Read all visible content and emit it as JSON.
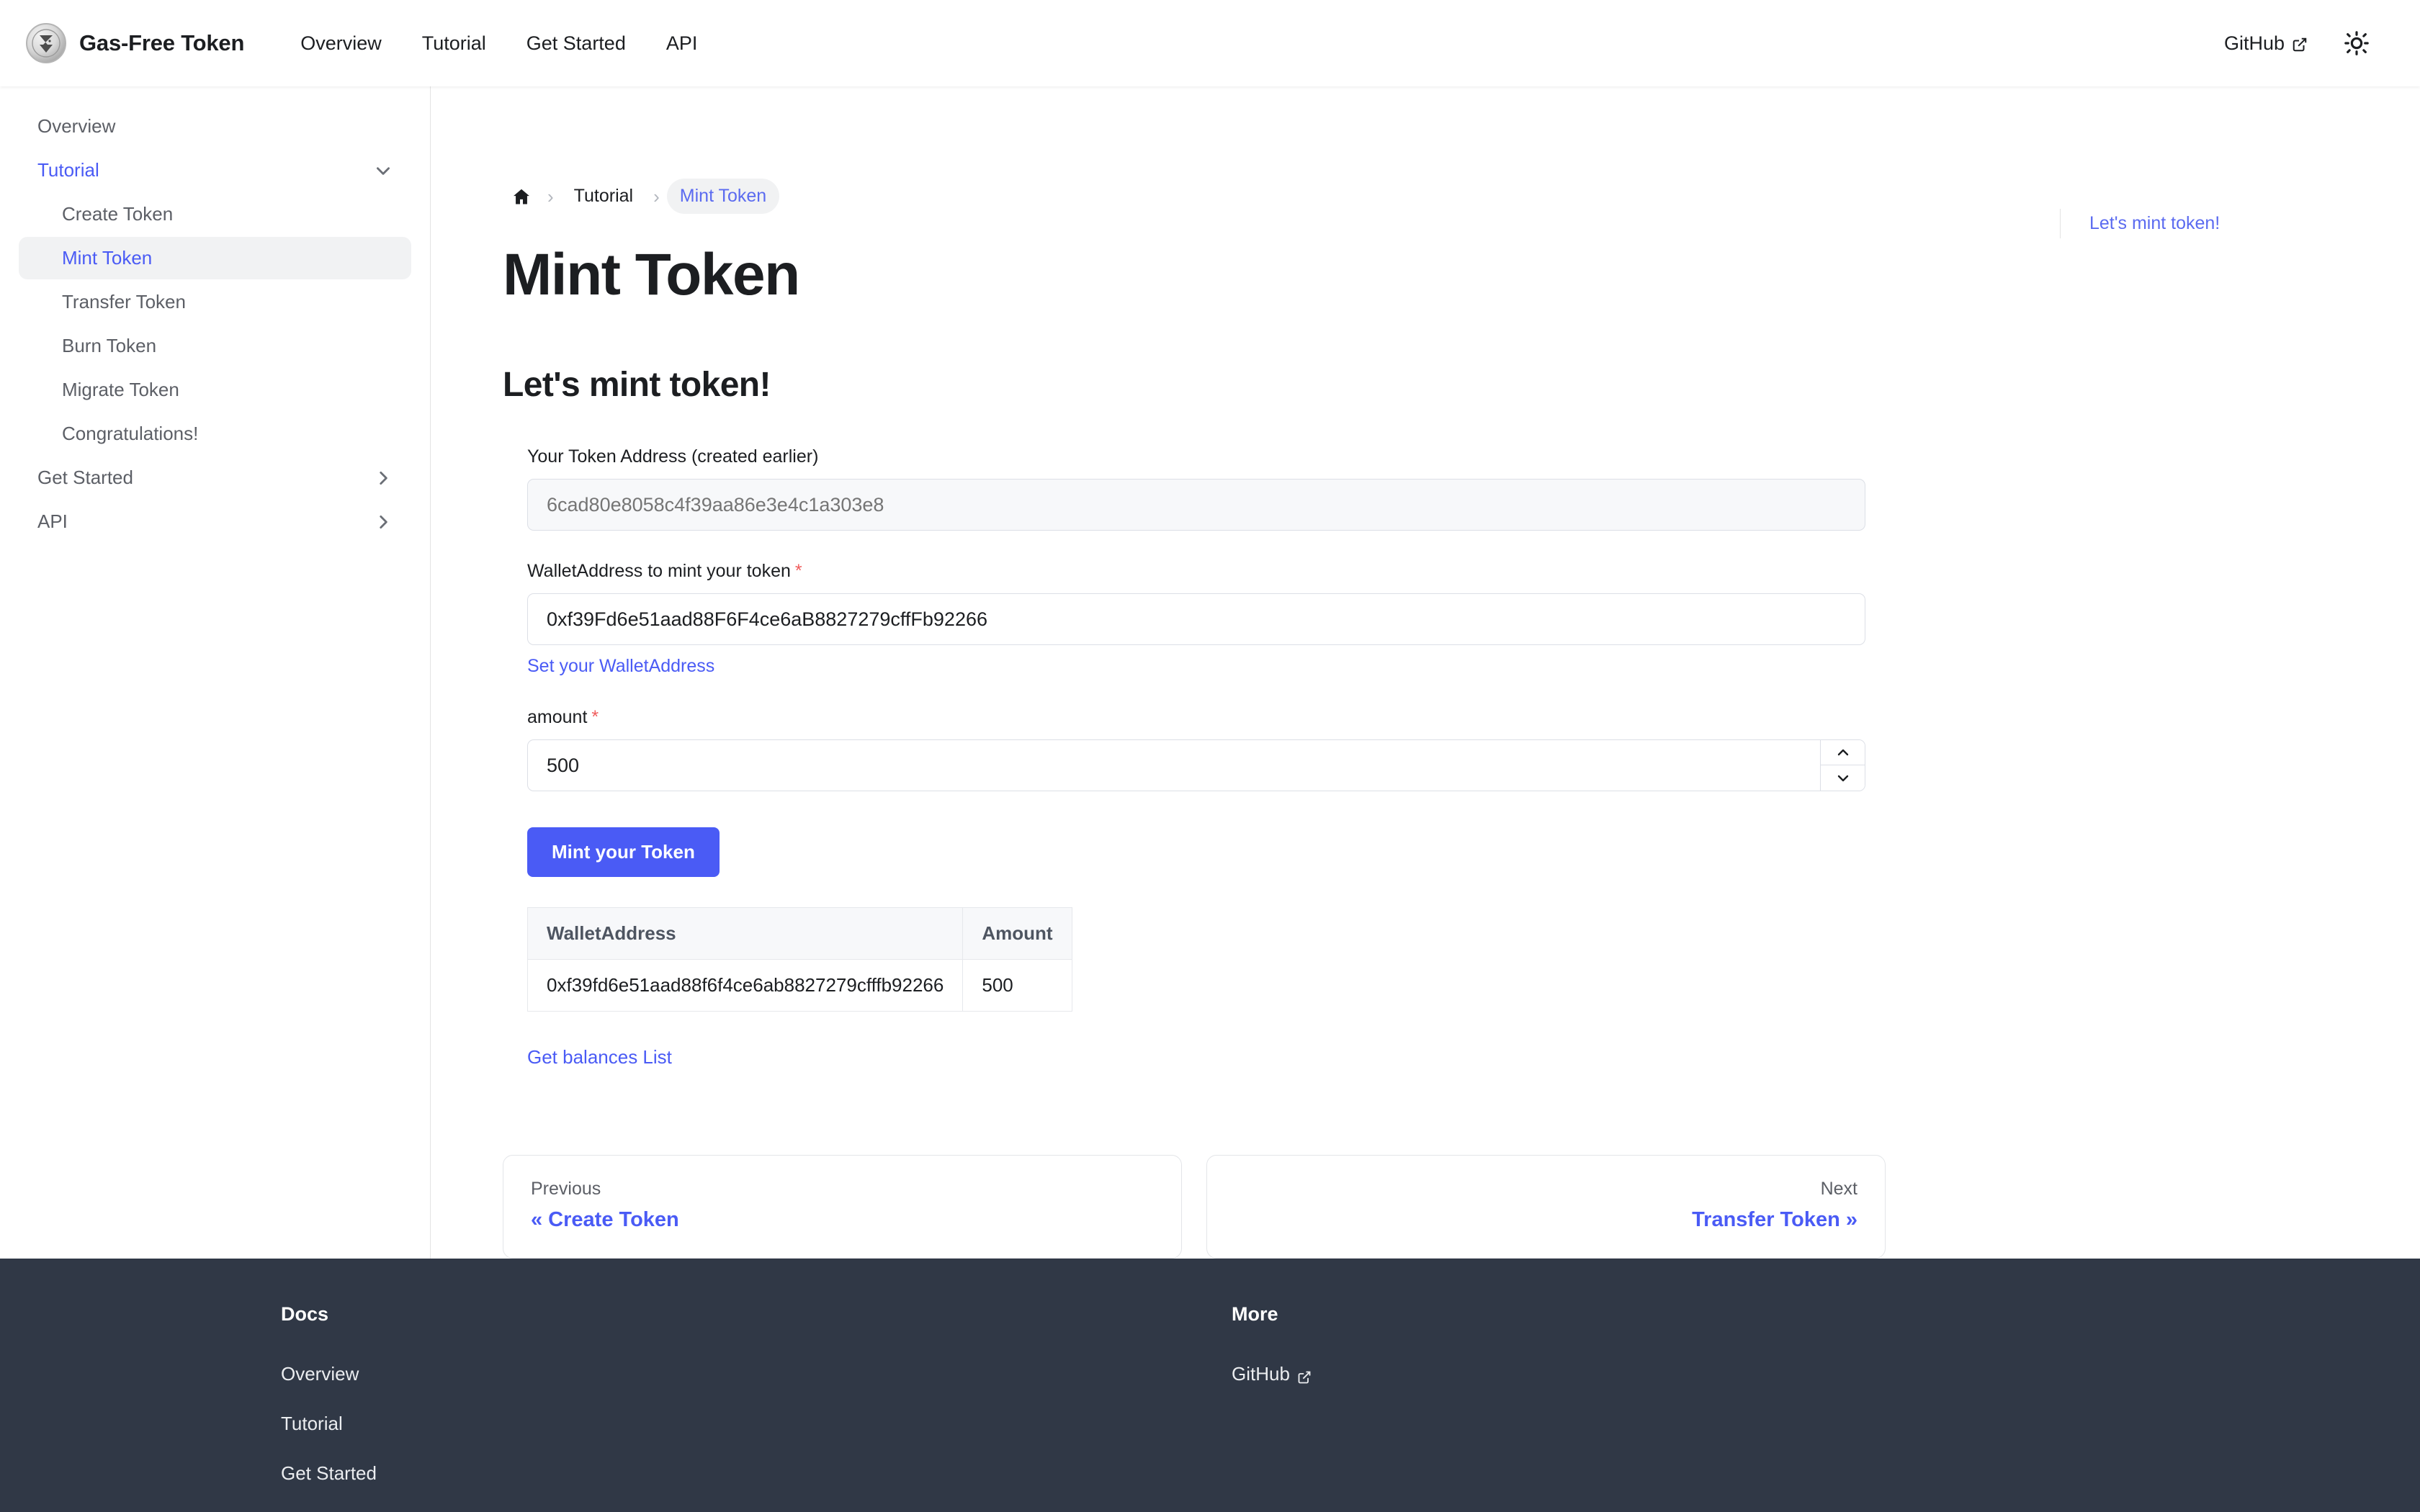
{
  "navbar": {
    "brand": "Gas-Free Token",
    "logo_icon": "gas-free-token-coin-logo",
    "links": [
      "Overview",
      "Tutorial",
      "Get Started",
      "API"
    ],
    "github_label": "GitHub",
    "github_icon": "external-link-icon",
    "theme_icon": "sun-icon"
  },
  "sidebar": {
    "items": [
      {
        "label": "Overview",
        "level": 1,
        "state": "normal",
        "caret": "none"
      },
      {
        "label": "Tutorial",
        "level": 1,
        "state": "category-open",
        "caret": "chevron-down-icon"
      },
      {
        "label": "Create Token",
        "level": 2,
        "state": "normal",
        "caret": "none"
      },
      {
        "label": "Mint Token",
        "level": 2,
        "state": "active",
        "caret": "none"
      },
      {
        "label": "Transfer Token",
        "level": 2,
        "state": "normal",
        "caret": "none"
      },
      {
        "label": "Burn Token",
        "level": 2,
        "state": "normal",
        "caret": "none"
      },
      {
        "label": "Migrate Token",
        "level": 2,
        "state": "normal",
        "caret": "none"
      },
      {
        "label": "Congratulations!",
        "level": 2,
        "state": "normal",
        "caret": "none"
      },
      {
        "label": "Get Started",
        "level": 1,
        "state": "normal",
        "caret": "chevron-right-icon"
      },
      {
        "label": "API",
        "level": 1,
        "state": "normal",
        "caret": "chevron-right-icon"
      }
    ]
  },
  "breadcrumb": {
    "home_icon": "home-icon",
    "separator": "›",
    "items": [
      "Tutorial",
      "Mint Token"
    ]
  },
  "main": {
    "page_title": "Mint Token",
    "section_title": "Let's mint token!",
    "token_address": {
      "label": "Your Token Address (created earlier)",
      "placeholder": "6cad80e8058c4f39aa86e3e4c1a303e8",
      "value": ""
    },
    "wallet_address": {
      "label": "WalletAddress to mint your token",
      "required_mark": "*",
      "value": "0xf39Fd6e51aad88F6F4ce6aB8827279cffFb92266",
      "helper_link": "Set your WalletAddress"
    },
    "amount": {
      "label": "amount",
      "required_mark": "*",
      "value": "500",
      "increment_icon": "chevron-up-icon",
      "decrement_icon": "chevron-down-icon"
    },
    "mint_button": "Mint your Token",
    "table": {
      "headers": [
        "WalletAddress",
        "Amount"
      ],
      "rows": [
        [
          "0xf39fd6e51aad88f6f4ce6ab8827279cfffb92266",
          "500"
        ]
      ]
    },
    "balances_link": "Get balances List"
  },
  "pager": {
    "previous": {
      "kicker": "Previous",
      "label": "« Create Token"
    },
    "next": {
      "kicker": "Next",
      "label": "Transfer Token »"
    }
  },
  "toc": {
    "links": [
      "Let's mint token!"
    ]
  },
  "footer": {
    "columns": [
      {
        "title": "Docs",
        "links": [
          {
            "label": "Overview",
            "external": false
          },
          {
            "label": "Tutorial",
            "external": false
          },
          {
            "label": "Get Started",
            "external": false
          }
        ]
      },
      {
        "title": "More",
        "links": [
          {
            "label": "GitHub",
            "external": true
          }
        ]
      }
    ],
    "external_icon": "external-link-icon"
  },
  "colors": {
    "accent": "#4a5bf5",
    "accent_link": "#5b6bf0",
    "text": "#1c1e21",
    "muted": "#5c5f66",
    "required": "#f05c5c",
    "footer_bg": "#303846",
    "border": "#e3e3e3",
    "input_disabled_bg": "#f7f8fa"
  }
}
